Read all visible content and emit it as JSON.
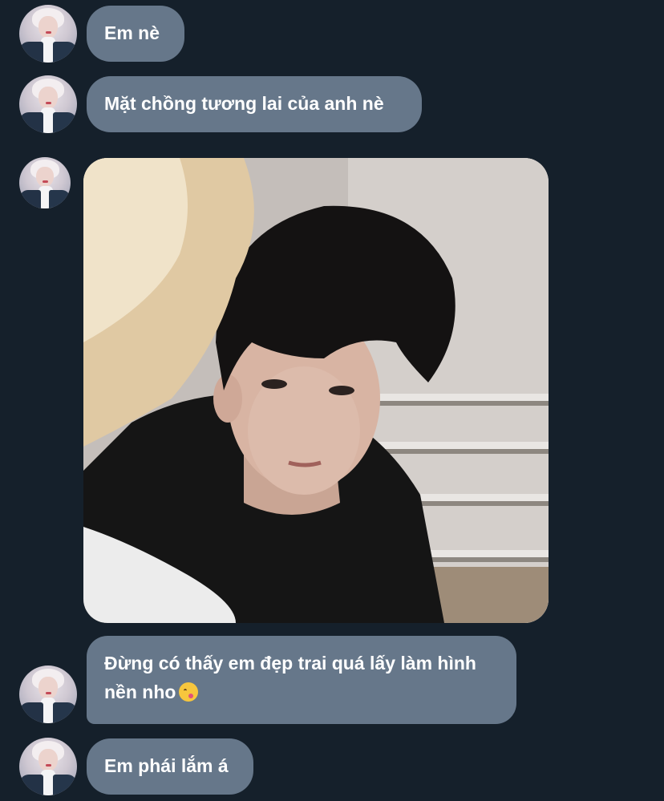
{
  "messages": [
    {
      "type": "text",
      "text": "Em nè"
    },
    {
      "type": "text",
      "text": "Mặt chồng tương lai của anh nè"
    },
    {
      "type": "image",
      "alt": "photo"
    },
    {
      "type": "text",
      "text": "Đừng có thấy em đẹp trai quá lấy làm hình nền nho",
      "emoji": "face-with-hand-over-mouth-emoji"
    },
    {
      "type": "text",
      "text": "Em phái lắm á"
    }
  ],
  "colors": {
    "background": "#15202b",
    "bubble": "#66778a",
    "text": "#ffffff"
  }
}
